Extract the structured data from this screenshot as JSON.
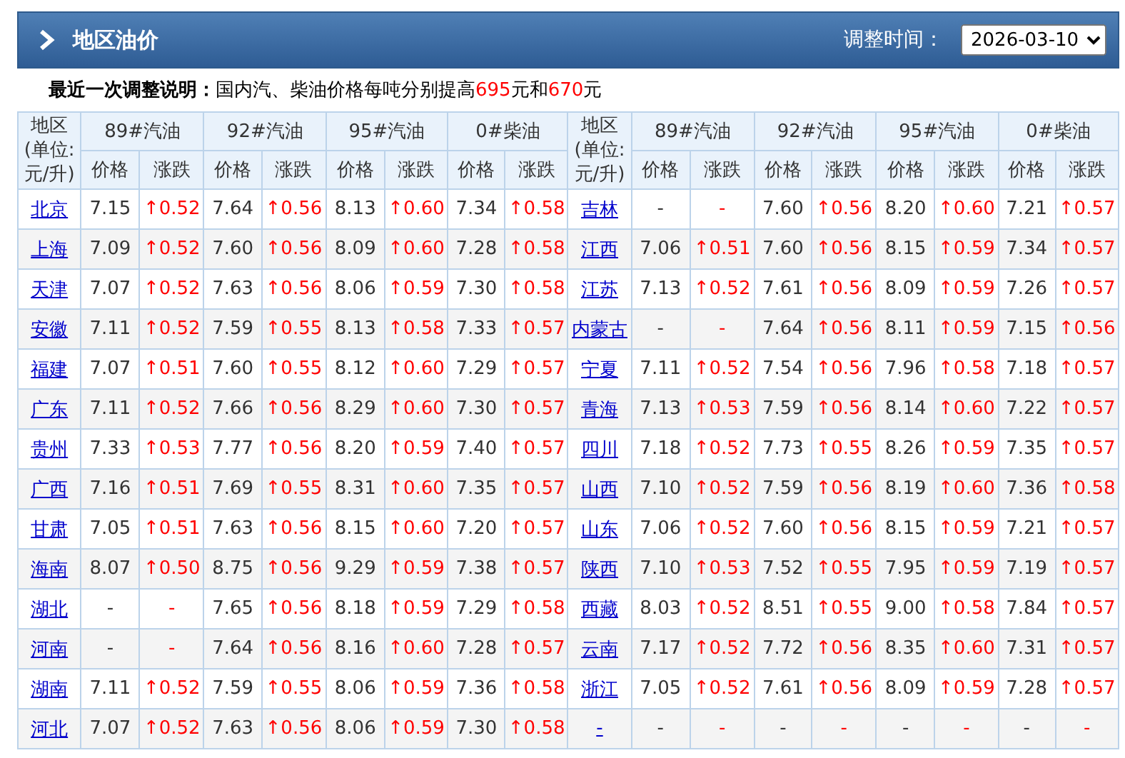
{
  "header": {
    "title": "地区油价",
    "date_label": "调整时间：",
    "date_value": "2026-03-10"
  },
  "note": {
    "label": "最近一次调整说明：",
    "parts": [
      {
        "text": "国内汽、柴油价格每吨分别提高",
        "highlight": false
      },
      {
        "text": "695",
        "highlight": true
      },
      {
        "text": "元和",
        "highlight": false
      },
      {
        "text": "670",
        "highlight": true
      },
      {
        "text": "元",
        "highlight": false
      }
    ]
  },
  "table": {
    "header_groups": [
      {
        "region": "地区(单位:元/升)",
        "fuels": [
          {
            "name": "89#汽油",
            "sub": [
              "价格",
              "涨跌"
            ]
          },
          {
            "name": "92#汽油",
            "sub": [
              "价格",
              "涨跌"
            ]
          },
          {
            "name": "95#汽油",
            "sub": [
              "价格",
              "涨跌"
            ]
          },
          {
            "name": "0#柴油",
            "sub": [
              "价格",
              "涨跌"
            ]
          }
        ]
      },
      {
        "region": "地区(单位:元/升)",
        "fuels": [
          {
            "name": "89#汽油",
            "sub": [
              "价格",
              "涨跌"
            ]
          },
          {
            "name": "92#汽油",
            "sub": [
              "价格",
              "涨跌"
            ]
          },
          {
            "name": "95#汽油",
            "sub": [
              "价格",
              "涨跌"
            ]
          },
          {
            "name": "0#柴油",
            "sub": [
              "价格",
              "涨跌"
            ]
          }
        ]
      }
    ],
    "rows": [
      {
        "left": {
          "region": "北京",
          "cells": [
            "7.15",
            "↑0.52",
            "7.64",
            "↑0.56",
            "8.13",
            "↑0.60",
            "7.34",
            "↑0.58"
          ]
        },
        "right": {
          "region": "吉林",
          "cells": [
            "-",
            "-",
            "7.60",
            "↑0.56",
            "8.20",
            "↑0.60",
            "7.21",
            "↑0.57"
          ]
        }
      },
      {
        "left": {
          "region": "上海",
          "cells": [
            "7.09",
            "↑0.52",
            "7.60",
            "↑0.56",
            "8.09",
            "↑0.60",
            "7.28",
            "↑0.58"
          ]
        },
        "right": {
          "region": "江西",
          "cells": [
            "7.06",
            "↑0.51",
            "7.60",
            "↑0.56",
            "8.15",
            "↑0.59",
            "7.34",
            "↑0.57"
          ]
        }
      },
      {
        "left": {
          "region": "天津",
          "cells": [
            "7.07",
            "↑0.52",
            "7.63",
            "↑0.56",
            "8.06",
            "↑0.59",
            "7.30",
            "↑0.58"
          ]
        },
        "right": {
          "region": "江苏",
          "cells": [
            "7.13",
            "↑0.52",
            "7.61",
            "↑0.56",
            "8.09",
            "↑0.59",
            "7.26",
            "↑0.57"
          ]
        }
      },
      {
        "left": {
          "region": "安徽",
          "cells": [
            "7.11",
            "↑0.52",
            "7.59",
            "↑0.55",
            "8.13",
            "↑0.58",
            "7.33",
            "↑0.57"
          ]
        },
        "right": {
          "region": "内蒙古",
          "cells": [
            "-",
            "-",
            "7.64",
            "↑0.56",
            "8.11",
            "↑0.59",
            "7.15",
            "↑0.56"
          ]
        }
      },
      {
        "left": {
          "region": "福建",
          "cells": [
            "7.07",
            "↑0.51",
            "7.60",
            "↑0.55",
            "8.12",
            "↑0.60",
            "7.29",
            "↑0.57"
          ]
        },
        "right": {
          "region": "宁夏",
          "cells": [
            "7.11",
            "↑0.52",
            "7.54",
            "↑0.56",
            "7.96",
            "↑0.58",
            "7.18",
            "↑0.57"
          ]
        }
      },
      {
        "left": {
          "region": "广东",
          "cells": [
            "7.11",
            "↑0.52",
            "7.66",
            "↑0.56",
            "8.29",
            "↑0.60",
            "7.30",
            "↑0.57"
          ]
        },
        "right": {
          "region": "青海",
          "cells": [
            "7.13",
            "↑0.53",
            "7.59",
            "↑0.56",
            "8.14",
            "↑0.60",
            "7.22",
            "↑0.57"
          ]
        }
      },
      {
        "left": {
          "region": "贵州",
          "cells": [
            "7.33",
            "↑0.53",
            "7.77",
            "↑0.56",
            "8.20",
            "↑0.59",
            "7.40",
            "↑0.57"
          ]
        },
        "right": {
          "region": "四川",
          "cells": [
            "7.18",
            "↑0.52",
            "7.73",
            "↑0.55",
            "8.26",
            "↑0.59",
            "7.35",
            "↑0.57"
          ]
        }
      },
      {
        "left": {
          "region": "广西",
          "cells": [
            "7.16",
            "↑0.51",
            "7.69",
            "↑0.55",
            "8.31",
            "↑0.60",
            "7.35",
            "↑0.57"
          ]
        },
        "right": {
          "region": "山西",
          "cells": [
            "7.10",
            "↑0.52",
            "7.59",
            "↑0.56",
            "8.19",
            "↑0.60",
            "7.36",
            "↑0.58"
          ]
        }
      },
      {
        "left": {
          "region": "甘肃",
          "cells": [
            "7.05",
            "↑0.51",
            "7.63",
            "↑0.56",
            "8.15",
            "↑0.60",
            "7.20",
            "↑0.57"
          ]
        },
        "right": {
          "region": "山东",
          "cells": [
            "7.06",
            "↑0.52",
            "7.60",
            "↑0.56",
            "8.15",
            "↑0.59",
            "7.21",
            "↑0.57"
          ]
        }
      },
      {
        "left": {
          "region": "海南",
          "cells": [
            "8.07",
            "↑0.50",
            "8.75",
            "↑0.56",
            "9.29",
            "↑0.59",
            "7.38",
            "↑0.57"
          ]
        },
        "right": {
          "region": "陕西",
          "cells": [
            "7.10",
            "↑0.53",
            "7.52",
            "↑0.55",
            "7.95",
            "↑0.59",
            "7.19",
            "↑0.57"
          ]
        }
      },
      {
        "left": {
          "region": "湖北",
          "cells": [
            "-",
            "-",
            "7.65",
            "↑0.56",
            "8.18",
            "↑0.59",
            "7.29",
            "↑0.58"
          ]
        },
        "right": {
          "region": "西藏",
          "cells": [
            "8.03",
            "↑0.52",
            "8.51",
            "↑0.55",
            "9.00",
            "↑0.58",
            "7.84",
            "↑0.57"
          ]
        }
      },
      {
        "left": {
          "region": "河南",
          "cells": [
            "-",
            "-",
            "7.64",
            "↑0.56",
            "8.16",
            "↑0.60",
            "7.28",
            "↑0.57"
          ]
        },
        "right": {
          "region": "云南",
          "cells": [
            "7.17",
            "↑0.52",
            "7.72",
            "↑0.56",
            "8.35",
            "↑0.60",
            "7.31",
            "↑0.57"
          ]
        }
      },
      {
        "left": {
          "region": "湖南",
          "cells": [
            "7.11",
            "↑0.52",
            "7.59",
            "↑0.55",
            "8.06",
            "↑0.59",
            "7.36",
            "↑0.58"
          ]
        },
        "right": {
          "region": "浙江",
          "cells": [
            "7.05",
            "↑0.52",
            "7.61",
            "↑0.56",
            "8.09",
            "↑0.59",
            "7.28",
            "↑0.57"
          ]
        }
      },
      {
        "left": {
          "region": "河北",
          "cells": [
            "7.07",
            "↑0.52",
            "7.63",
            "↑0.56",
            "8.06",
            "↑0.59",
            "7.30",
            "↑0.58"
          ]
        },
        "right": {
          "region": "-",
          "cells": [
            "-",
            "-",
            "-",
            "-",
            "-",
            "-",
            "-",
            "-"
          ]
        }
      }
    ]
  }
}
